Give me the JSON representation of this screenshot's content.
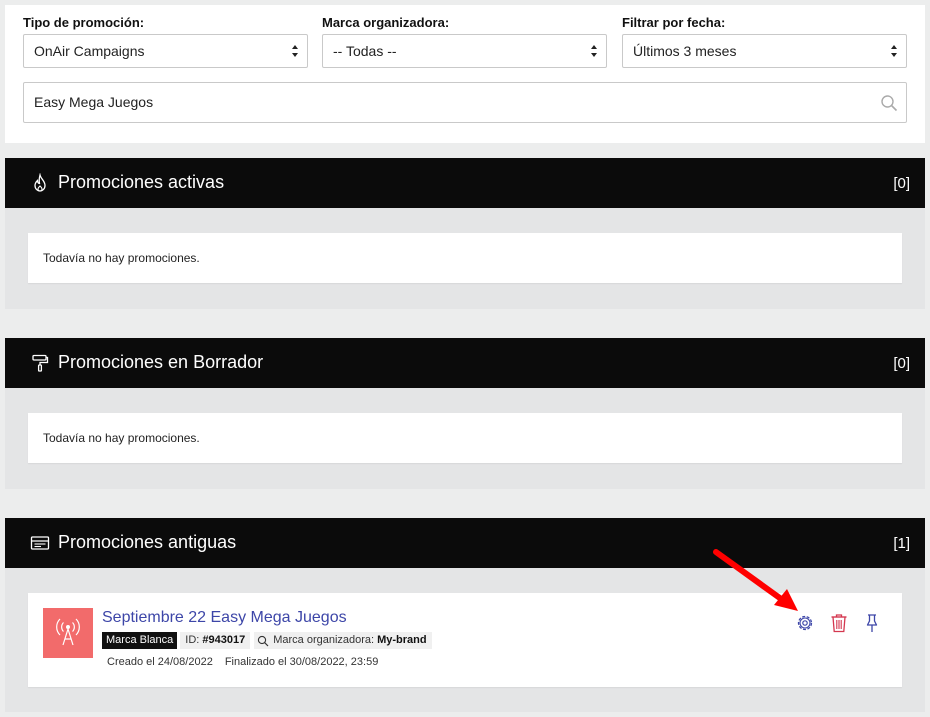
{
  "filters": {
    "type": {
      "label": "Tipo de promoción:",
      "value": "OnAir Campaigns"
    },
    "brand": {
      "label": "Marca organizadora:",
      "value": "-- Todas --"
    },
    "date": {
      "label": "Filtrar por fecha:",
      "value": "Últimos 3 meses"
    },
    "search": {
      "value": "Easy Mega Juegos",
      "icon": "search-icon"
    }
  },
  "sections": {
    "active": {
      "title": "Promociones activas",
      "count": "[0]",
      "empty": "Todavía no hay promociones.",
      "icon": "fire-icon"
    },
    "drafts": {
      "title": "Promociones en Borrador",
      "count": "[0]",
      "empty": "Todavía no hay promociones.",
      "icon": "paint-roller-icon"
    },
    "old": {
      "title": "Promociones antiguas",
      "count": "[1]",
      "icon": "archive-icon"
    }
  },
  "promo": {
    "title": "Septiembre 22 Easy Mega Juegos",
    "tag": "Marca Blanca",
    "id_label": "ID:",
    "id_value": "#943017",
    "org_label": "Marca organizadora:",
    "org_value": "My-brand",
    "created": "Creado el 24/08/2022",
    "finished": "Finalizado el 30/08/2022, 23:59",
    "thumb_icon": "broadcast-antenna-icon",
    "actions": [
      "settings-icon",
      "trash-icon",
      "pin-icon"
    ]
  },
  "colors": {
    "header_bg": "#0b0b0b",
    "link": "#3d46a8",
    "danger": "#d4374f",
    "thumb": "#f26b6b",
    "annotation_arrow": "#ff0000"
  }
}
